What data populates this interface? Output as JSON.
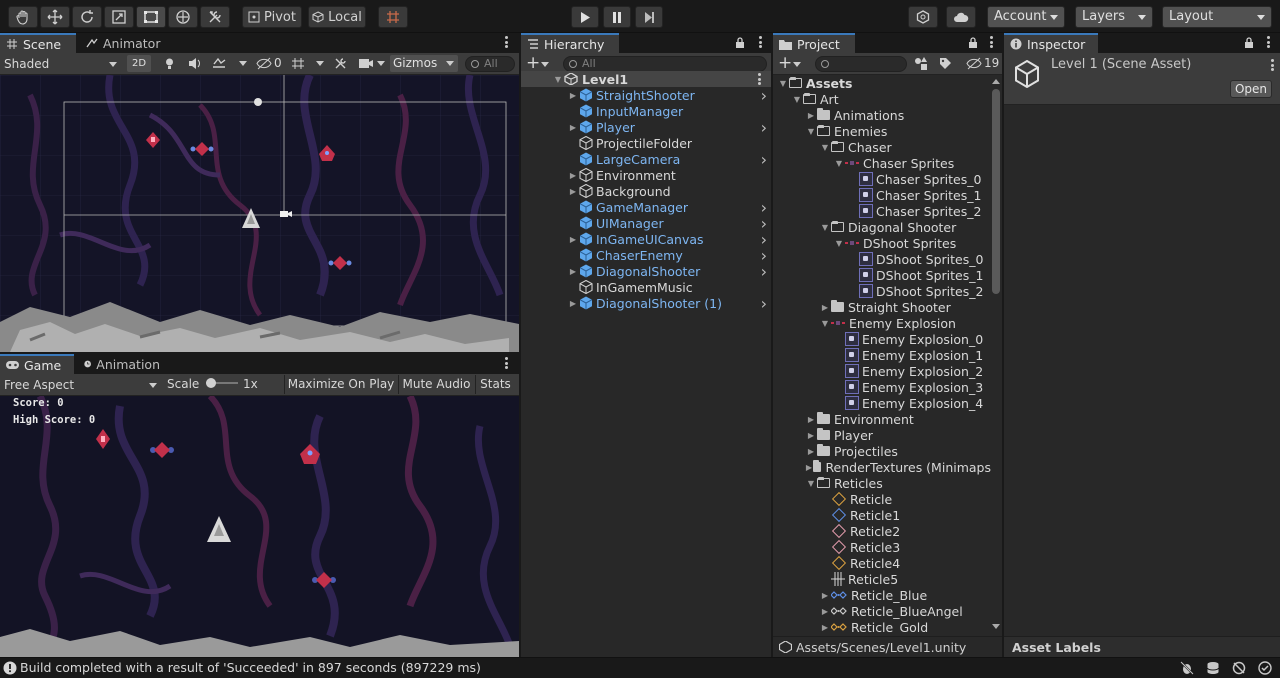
{
  "toolbar": {
    "pivot_label": "Pivot",
    "local_label": "Local",
    "account_label": "Account",
    "layers_label": "Layers",
    "layout_label": "Layout"
  },
  "scene_panel": {
    "tabs": [
      {
        "label": "Scene"
      },
      {
        "label": "Animator"
      }
    ],
    "shading_mode": "Shaded",
    "mode_2d": "2D",
    "hidden_count": "0",
    "gizmos_label": "Gizmos",
    "search_placeholder": "All"
  },
  "game_panel": {
    "tabs": [
      {
        "label": "Game"
      },
      {
        "label": "Animation"
      }
    ],
    "aspect": "Free Aspect",
    "scale_label": "Scale",
    "scale_value": "1x",
    "maximize_label": "Maximize On Play",
    "mute_label": "Mute Audio",
    "stats_label": "Stats",
    "score_text": "Score: 0",
    "high_score_text": "High Score: 0"
  },
  "hierarchy": {
    "tab_label": "Hierarchy",
    "search_placeholder": "All",
    "scene_name": "Level1",
    "items": [
      {
        "label": "StraightShooter",
        "prefab": true,
        "expandable": true
      },
      {
        "label": "InputManager",
        "prefab": true,
        "expandable": false
      },
      {
        "label": "Player",
        "prefab": true,
        "expandable": true
      },
      {
        "label": "ProjectileFolder",
        "prefab": false,
        "expandable": false
      },
      {
        "label": "LargeCamera",
        "prefab": true,
        "expandable": false
      },
      {
        "label": "Environment",
        "prefab": false,
        "expandable": true
      },
      {
        "label": "Background",
        "prefab": false,
        "expandable": true
      },
      {
        "label": "GameManager",
        "prefab": true,
        "expandable": false
      },
      {
        "label": "UIManager",
        "prefab": true,
        "expandable": false
      },
      {
        "label": "InGameUICanvas",
        "prefab": true,
        "expandable": true
      },
      {
        "label": "ChaserEnemy",
        "prefab": true,
        "expandable": false
      },
      {
        "label": "DiagonalShooter",
        "prefab": true,
        "expandable": true
      },
      {
        "label": "InGamemMusic",
        "prefab": false,
        "expandable": false
      },
      {
        "label": "DiagonalShooter (1)",
        "prefab": true,
        "expandable": true
      }
    ]
  },
  "project": {
    "tab_label": "Project",
    "hidden_count": "19",
    "footer_path": "Assets/Scenes/Level1.unity",
    "rows": [
      {
        "label": "Assets",
        "kind": "folder-open",
        "level": 0,
        "arrow": "down",
        "bold": true
      },
      {
        "label": "Art",
        "kind": "folder-open",
        "level": 1,
        "arrow": "down"
      },
      {
        "label": "Animations",
        "kind": "folder",
        "level": 2,
        "arrow": "right"
      },
      {
        "label": "Enemies",
        "kind": "folder-open",
        "level": 2,
        "arrow": "down"
      },
      {
        "label": "Chaser",
        "kind": "folder-open",
        "level": 3,
        "arrow": "down"
      },
      {
        "label": "Chaser Sprites",
        "kind": "sheet",
        "level": 4,
        "arrow": "down"
      },
      {
        "label": "Chaser Sprites_0",
        "kind": "sprite",
        "level": 5,
        "arrow": ""
      },
      {
        "label": "Chaser Sprites_1",
        "kind": "sprite",
        "level": 5,
        "arrow": ""
      },
      {
        "label": "Chaser Sprites_2",
        "kind": "sprite",
        "level": 5,
        "arrow": ""
      },
      {
        "label": "Diagonal Shooter",
        "kind": "folder-open",
        "level": 3,
        "arrow": "down"
      },
      {
        "label": "DShoot Sprites",
        "kind": "sheet",
        "level": 4,
        "arrow": "down"
      },
      {
        "label": "DShoot Sprites_0",
        "kind": "sprite",
        "level": 5,
        "arrow": ""
      },
      {
        "label": "DShoot Sprites_1",
        "kind": "sprite",
        "level": 5,
        "arrow": ""
      },
      {
        "label": "DShoot Sprites_2",
        "kind": "sprite",
        "level": 5,
        "arrow": ""
      },
      {
        "label": "Straight Shooter",
        "kind": "folder",
        "level": 3,
        "arrow": "right"
      },
      {
        "label": "Enemy Explosion",
        "kind": "sheet",
        "level": 3,
        "arrow": "down"
      },
      {
        "label": "Enemy Explosion_0",
        "kind": "sprite",
        "level": 4,
        "arrow": ""
      },
      {
        "label": "Enemy Explosion_1",
        "kind": "sprite",
        "level": 4,
        "arrow": ""
      },
      {
        "label": "Enemy Explosion_2",
        "kind": "sprite",
        "level": 4,
        "arrow": ""
      },
      {
        "label": "Enemy Explosion_3",
        "kind": "sprite",
        "level": 4,
        "arrow": ""
      },
      {
        "label": "Enemy Explosion_4",
        "kind": "sprite",
        "level": 4,
        "arrow": ""
      },
      {
        "label": "Environment",
        "kind": "folder",
        "level": 2,
        "arrow": "right"
      },
      {
        "label": "Player",
        "kind": "folder",
        "level": 2,
        "arrow": "right"
      },
      {
        "label": "Projectiles",
        "kind": "folder",
        "level": 2,
        "arrow": "right"
      },
      {
        "label": "RenderTextures (Minimaps",
        "kind": "folder",
        "level": 2,
        "arrow": "right"
      },
      {
        "label": "Reticles",
        "kind": "folder-open",
        "level": 2,
        "arrow": "down"
      },
      {
        "label": "Reticle",
        "kind": "diamond-gold",
        "level": 3,
        "arrow": ""
      },
      {
        "label": "Reticle1",
        "kind": "diamond-blue",
        "level": 3,
        "arrow": ""
      },
      {
        "label": "Reticle2",
        "kind": "diamond-pink",
        "level": 3,
        "arrow": ""
      },
      {
        "label": "Reticle3",
        "kind": "diamond-pink",
        "level": 3,
        "arrow": ""
      },
      {
        "label": "Reticle4",
        "kind": "diamond-gold",
        "level": 3,
        "arrow": ""
      },
      {
        "label": "Reticle5",
        "kind": "cross",
        "level": 3,
        "arrow": ""
      },
      {
        "label": "Reticle_Blue",
        "kind": "multi-blue",
        "level": 3,
        "arrow": "right"
      },
      {
        "label": "Reticle_BlueAngel",
        "kind": "multi-white",
        "level": 3,
        "arrow": "right"
      },
      {
        "label": "Reticle_Gold",
        "kind": "multi-gold",
        "level": 3,
        "arrow": "right"
      }
    ]
  },
  "inspector": {
    "tab_label": "Inspector",
    "title": "Level 1 (Scene Asset)",
    "open_label": "Open",
    "asset_labels": "Asset Labels"
  },
  "status": {
    "message": "Build completed with a result of 'Succeeded' in 897 seconds (897229 ms)"
  },
  "colors": {
    "accent": "#3a79bb",
    "prefab_text": "#7eb6f2",
    "space_bg": "#141427"
  }
}
